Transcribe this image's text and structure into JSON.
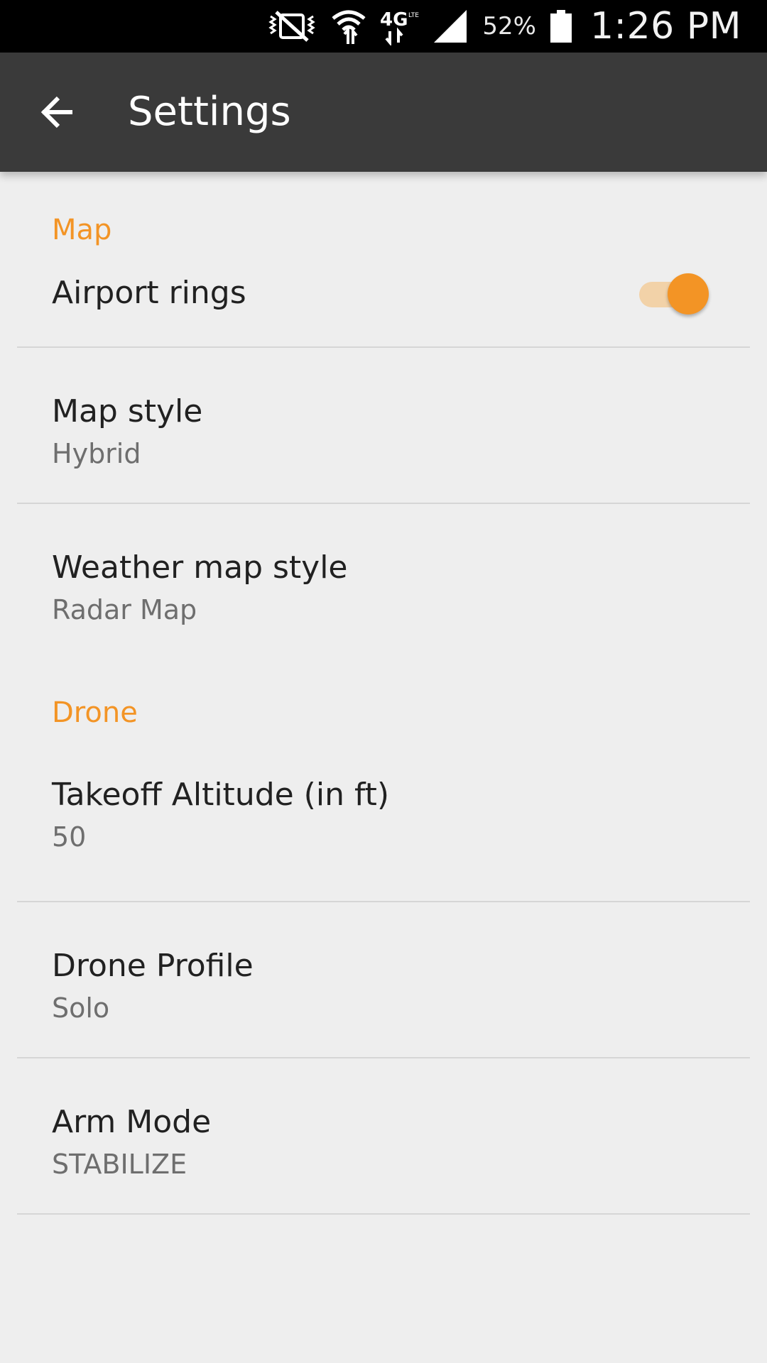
{
  "status_bar": {
    "battery_percent": "52%",
    "time": "1:26 PM",
    "icons": [
      "vibrate-icon",
      "wifi-icon",
      "4g-lte-icon",
      "cell-signal-icon",
      "battery-icon"
    ]
  },
  "app_bar": {
    "title": "Settings",
    "back_icon": "arrow-left-icon"
  },
  "sections": {
    "map": {
      "header": "Map",
      "airport_rings": {
        "title": "Airport rings",
        "enabled": true
      },
      "map_style": {
        "title": "Map style",
        "value": "Hybrid"
      },
      "weather_map_style": {
        "title": "Weather map style",
        "value": "Radar Map"
      }
    },
    "drone": {
      "header": "Drone",
      "takeoff_altitude": {
        "title": "Takeoff Altitude (in ft)",
        "value": "50"
      },
      "drone_profile": {
        "title": "Drone Profile",
        "value": "Solo"
      },
      "arm_mode": {
        "title": "Arm Mode",
        "value": "STABILIZE"
      }
    }
  },
  "colors": {
    "accent": "#f39425",
    "app_bar": "#3a3a3a",
    "background": "#eeeeee"
  }
}
